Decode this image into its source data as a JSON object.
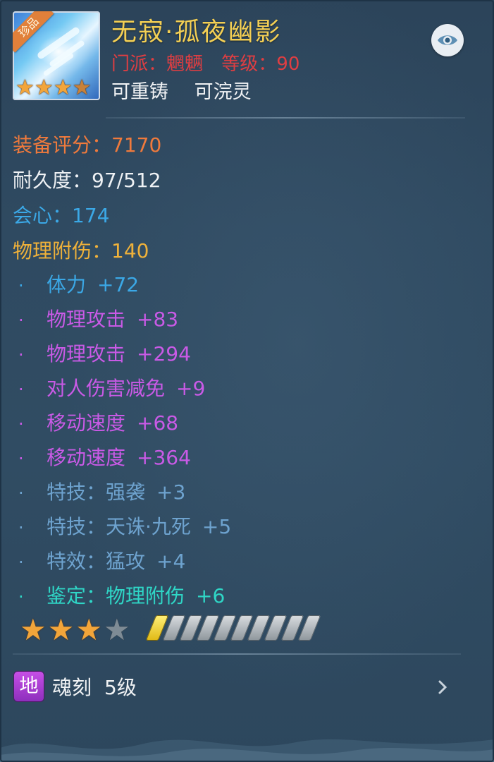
{
  "item": {
    "thumbnail_badge": "珍品",
    "thumbnail_stars": 4,
    "title": "无寂·孤夜幽影",
    "requirements": [
      "门派：魍魉",
      "等级：90"
    ],
    "flags": [
      "可重铸",
      "可浣灵"
    ]
  },
  "stats": {
    "score": "装备评分：7170",
    "durability": "耐久度：97/512",
    "crit": "会心：174",
    "phys_extra": "物理附伤：140"
  },
  "attributes": [
    {
      "name": "体力",
      "value": "+72",
      "tier": "blue"
    },
    {
      "name": "物理攻击",
      "value": "+83",
      "tier": "purple"
    },
    {
      "name": "物理攻击",
      "value": "+294",
      "tier": "purple"
    },
    {
      "name": "对人伤害减免",
      "value": "+9",
      "tier": "purple"
    },
    {
      "name": "移动速度",
      "value": "+68",
      "tier": "purple"
    },
    {
      "name": "移动速度",
      "value": "+364",
      "tier": "purple"
    },
    {
      "name": "特技：强袭",
      "value": "+3",
      "tier": "steel"
    },
    {
      "name": "特技：天诛·九死",
      "value": "+5",
      "tier": "steel"
    },
    {
      "name": "特效：猛攻",
      "value": "+4",
      "tier": "steel"
    },
    {
      "name": "鉴定：物理附伤",
      "value": "+6",
      "tier": "cyan"
    }
  ],
  "rating": {
    "stars_filled": 3,
    "stars_total": 4,
    "bars_filled": 1,
    "bars_total": 10
  },
  "soul": {
    "badge": "地",
    "label": "魂刻",
    "level": "5级"
  },
  "colors": {
    "title": "#f3cf54",
    "requirement": "#df3e42",
    "score": "#f07a3c",
    "crit": "#3ba8e6",
    "phys_extra": "#efb13a",
    "attr_blue": "#3ba8e6",
    "attr_purple": "#c95ae6",
    "attr_steel": "#6ea3cf",
    "attr_cyan": "#2fd6c6",
    "soul_badge": "#b043d6"
  },
  "icons": {
    "toggle": "eye-icon",
    "more": "chevron-right-icon",
    "star": "star-icon"
  }
}
